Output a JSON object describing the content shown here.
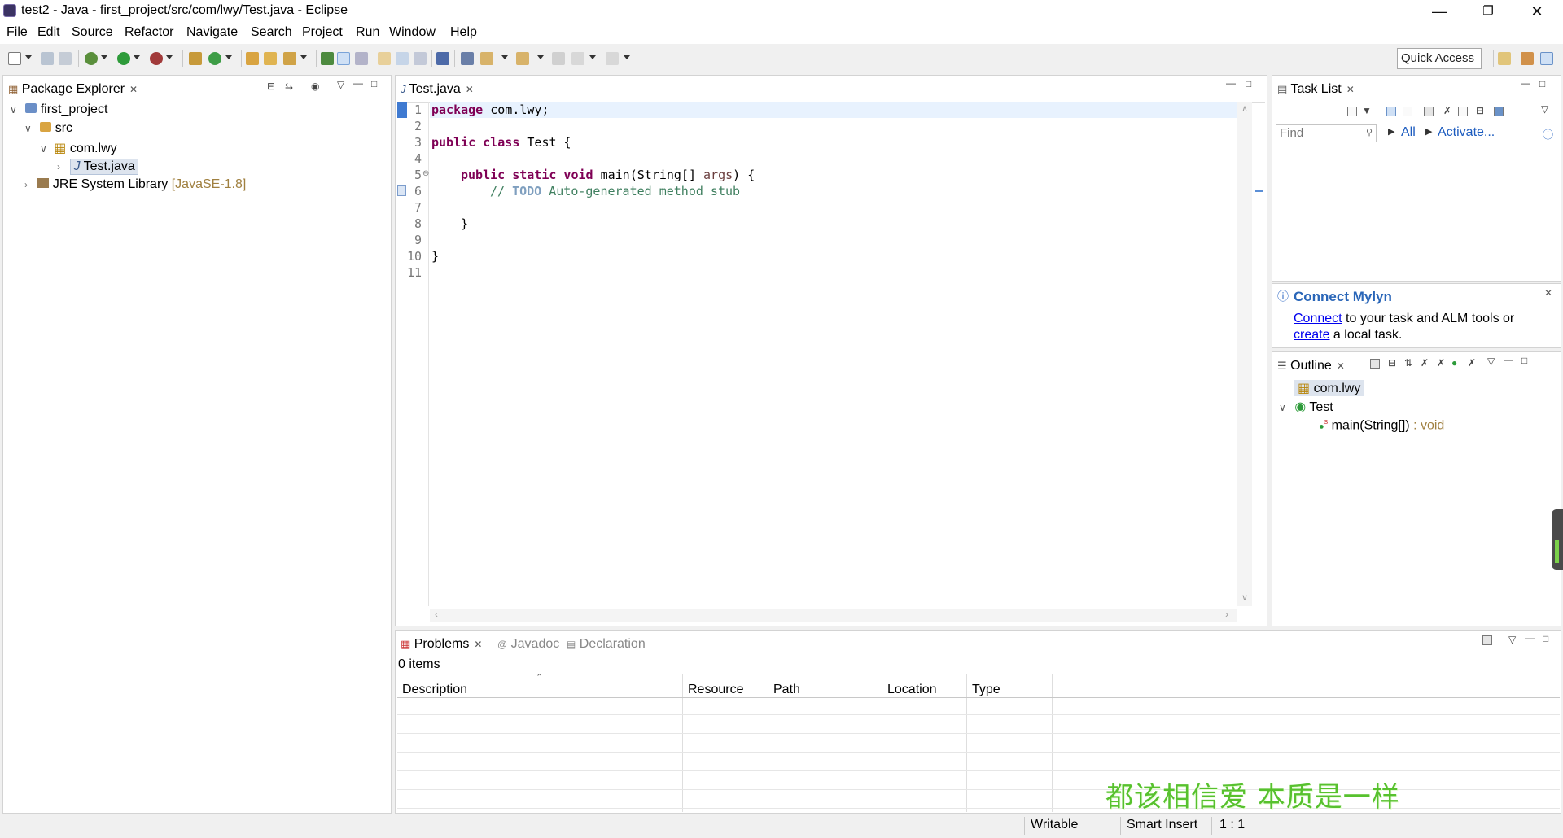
{
  "window": {
    "title": "test2 - Java - first_project/src/com/lwy/Test.java - Eclipse"
  },
  "menu": [
    "File",
    "Edit",
    "Source",
    "Refactor",
    "Navigate",
    "Search",
    "Project",
    "Run",
    "Window",
    "Help"
  ],
  "toolbar": {
    "quick_access": "Quick Access"
  },
  "package_explorer": {
    "tab": "Package Explorer",
    "tree": {
      "project": "first_project",
      "src": "src",
      "package": "com.lwy",
      "file": "Test.java",
      "jre": "JRE System Library",
      "jre_version": "[JavaSE-1.8]"
    }
  },
  "editor": {
    "tab": "Test.java",
    "line_numbers": [
      "1",
      "2",
      "3",
      "4",
      "5",
      "6",
      "7",
      "8",
      "9",
      "10",
      "11"
    ],
    "code": {
      "l1_kw": "package",
      "l1_rest": " com.lwy;",
      "l3_kw": "public class",
      "l3_rest": " Test {",
      "l5_kw": "public static void",
      "l5_rest": " main(String[] ",
      "l5_param": "args",
      "l5_end": ") {",
      "l6_comment_start": "// ",
      "l6_todo": "TODO",
      "l6_comment_rest": " Auto-generated method stub",
      "l8": "}",
      "l10": "}"
    }
  },
  "task_list": {
    "tab": "Task List",
    "find_placeholder": "Find",
    "all": "All",
    "activate": "Activate..."
  },
  "mylyn": {
    "title": "Connect Mylyn",
    "connect": "Connect",
    "text1": " to your task and ALM tools or",
    "create": "create",
    "text2": " a local task."
  },
  "outline": {
    "tab": "Outline",
    "package": "com.lwy",
    "class": "Test",
    "method": "main(String[])",
    "method_type": " : void"
  },
  "bottom": {
    "tabs": {
      "problems": "Problems",
      "javadoc": "Javadoc",
      "declaration": "Declaration"
    },
    "items": "0 items",
    "columns": [
      "Description",
      "Resource",
      "Path",
      "Location",
      "Type"
    ]
  },
  "status": {
    "writable": "Writable",
    "insert": "Smart Insert",
    "position": "1 : 1"
  },
  "banner": "都该相信爱  本质是一样"
}
